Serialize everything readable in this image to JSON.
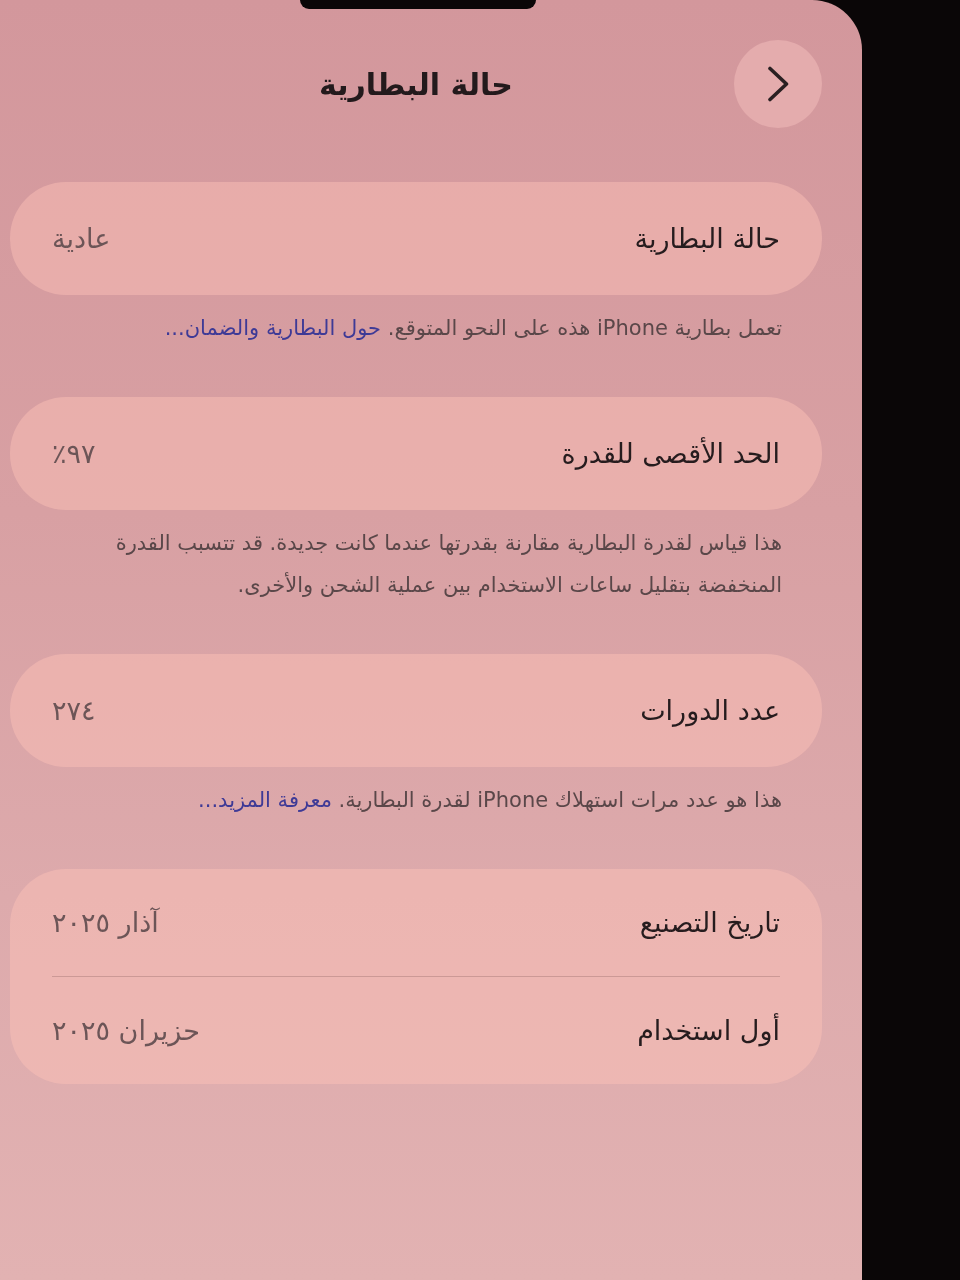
{
  "header": {
    "title": "حالة البطارية"
  },
  "sections": [
    {
      "rows": [
        {
          "label": "حالة البطارية",
          "value": "عادية"
        }
      ],
      "footer": {
        "text": "تعمل بطارية iPhone هذه على النحو المتوقع.",
        "link": "حول البطارية والضمان..."
      }
    },
    {
      "rows": [
        {
          "label": "الحد الأقصى للقدرة",
          "value": "٩٧٪"
        }
      ],
      "footer": {
        "text": "هذا قياس لقدرة البطارية مقارنة بقدرتها عندما كانت جديدة. قد تتسبب القدرة المنخفضة بتقليل ساعات الاستخدام بين عملية الشحن والأخرى."
      }
    },
    {
      "rows": [
        {
          "label": "عدد الدورات",
          "value": "٢٧٤"
        }
      ],
      "footer": {
        "text": "هذا هو عدد مرات استهلاك iPhone لقدرة البطارية.",
        "link": "معرفة المزيد..."
      }
    },
    {
      "rows": [
        {
          "label": "تاريخ التصنيع",
          "value": "آذار ٢٠٢٥"
        },
        {
          "label": "أول استخدام",
          "value": "حزيران ٢٠٢٥"
        }
      ]
    }
  ]
}
